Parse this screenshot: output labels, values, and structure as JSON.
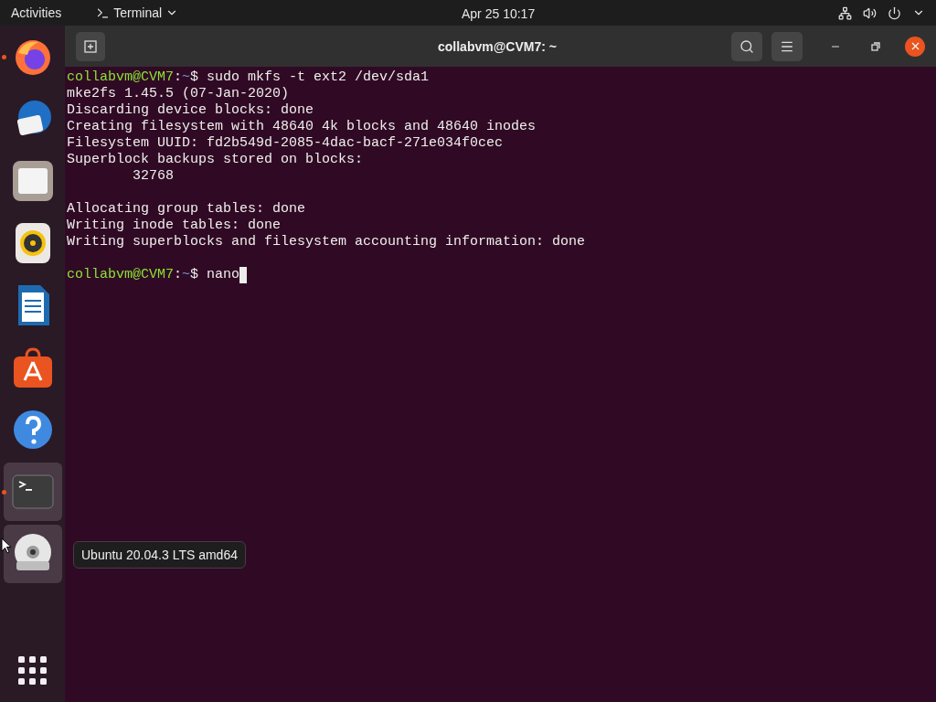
{
  "top_bar": {
    "activities": "Activities",
    "app_menu": "Terminal",
    "clock": "Apr 25  10:17"
  },
  "dock": {
    "items": [
      {
        "kind": "firefox",
        "running": true,
        "highlighted": false
      },
      {
        "kind": "thunderbird",
        "running": false,
        "highlighted": false
      },
      {
        "kind": "files",
        "running": false,
        "highlighted": false
      },
      {
        "kind": "rhythmbox",
        "running": false,
        "highlighted": false
      },
      {
        "kind": "writer",
        "running": false,
        "highlighted": false
      },
      {
        "kind": "software",
        "running": false,
        "highlighted": false
      },
      {
        "kind": "help",
        "running": false,
        "highlighted": false
      },
      {
        "kind": "terminal",
        "running": true,
        "highlighted": true
      },
      {
        "kind": "dvd",
        "running": false,
        "highlighted": true
      }
    ],
    "tooltip": "Ubuntu 20.04.3 LTS amd64"
  },
  "window": {
    "title": "collabvm@CVM7: ~"
  },
  "terminal": {
    "lines": [
      {
        "kind": "prompt",
        "user": "collabvm@CVM7",
        "sep": ":",
        "path": "~",
        "symbol": "$",
        "command": "sudo mkfs -t ext2 /dev/sda1",
        "cursor": false
      },
      {
        "kind": "output",
        "text": "mke2fs 1.45.5 (07-Jan-2020)"
      },
      {
        "kind": "output",
        "text": "Discarding device blocks: done"
      },
      {
        "kind": "output",
        "text": "Creating filesystem with 48640 4k blocks and 48640 inodes"
      },
      {
        "kind": "output",
        "text": "Filesystem UUID: fd2b549d-2085-4dac-bacf-271e034f0cec"
      },
      {
        "kind": "output",
        "text": "Superblock backups stored on blocks:"
      },
      {
        "kind": "output",
        "text": "        32768"
      },
      {
        "kind": "blank"
      },
      {
        "kind": "output",
        "text": "Allocating group tables: done"
      },
      {
        "kind": "output",
        "text": "Writing inode tables: done"
      },
      {
        "kind": "output",
        "text": "Writing superblocks and filesystem accounting information: done"
      },
      {
        "kind": "blank"
      },
      {
        "kind": "prompt",
        "user": "collabvm@CVM7",
        "sep": ":",
        "path": "~",
        "symbol": "$",
        "command": "nano",
        "cursor": true
      }
    ]
  }
}
